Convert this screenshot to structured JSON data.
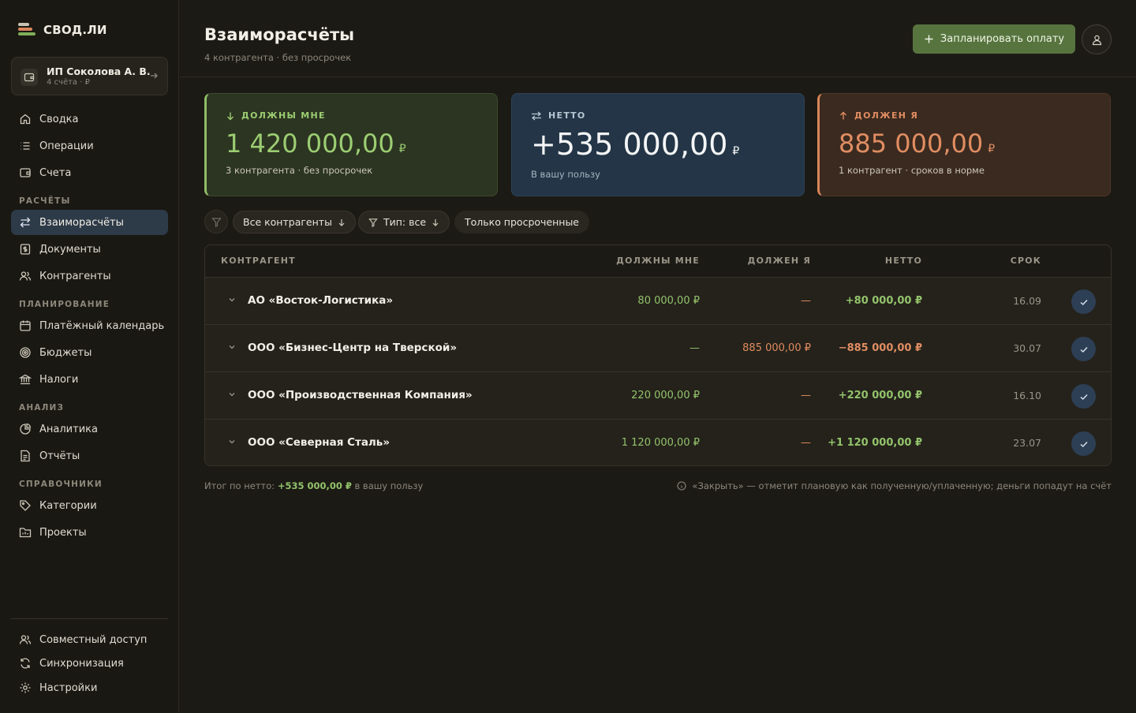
{
  "brand": {
    "name": "СВОД.ЛИ"
  },
  "account": {
    "name": "ИП Соколова А. В.",
    "sub": "4 счёта · ₽"
  },
  "nav": {
    "summary": "Сводка",
    "operations": "Операции",
    "accounts": "Счета",
    "section_settlements": "РАСЧЁТЫ",
    "settlements": "Взаиморасчёты",
    "documents": "Документы",
    "counterparties": "Контрагенты",
    "section_planning": "ПЛАНИРОВАНИЕ",
    "calendar": "Платёжный календарь",
    "budgets": "Бюджеты",
    "taxes": "Налоги",
    "section_analysis": "АНАЛИЗ",
    "analytics": "Аналитика",
    "reports": "Отчёты",
    "section_refs": "СПРАВОЧНИКИ",
    "categories": "Категории",
    "projects": "Проекты",
    "sharing": "Совместный доступ",
    "sync": "Синхронизация",
    "settings": "Настройки"
  },
  "header": {
    "title": "Взаиморасчёты",
    "subtitle": "4 контрагента · без просрочек",
    "plan_button": "Запланировать оплату"
  },
  "cards": {
    "owed": {
      "label": "ДОЛЖНЫ МНЕ",
      "value": "1 420 000,00",
      "currency": "₽",
      "note": "3 контрагента · без просрочек"
    },
    "net": {
      "label": "НЕТТО",
      "value": "+535 000,00",
      "currency": "₽",
      "note": "В вашу пользу"
    },
    "owe": {
      "label": "ДОЛЖЕН Я",
      "value": "885 000,00",
      "currency": "₽",
      "note": "1 контрагент · сроков в норме"
    }
  },
  "filters": {
    "counterparties": "Все контрагенты",
    "type": "Тип: все",
    "overdue": "Только просроченные"
  },
  "table": {
    "columns": {
      "counterparty": "КОНТРАГЕНТ",
      "owed": "ДОЛЖНЫ МНЕ",
      "owe": "ДОЛЖЕН Я",
      "net": "НЕТТО",
      "due": "СРОК"
    },
    "rows": [
      {
        "name": "АО «Восток-Логистика»",
        "owed": "80 000,00 ₽",
        "owe": "—",
        "net": "+80 000,00 ₽",
        "due": "16.09"
      },
      {
        "name": "ООО «Бизнес-Центр на Тверской»",
        "owed": "—",
        "owe": "885 000,00 ₽",
        "net": "−885 000,00 ₽",
        "due": "30.07"
      },
      {
        "name": "ООО «Производственная Компания»",
        "owed": "220 000,00 ₽",
        "owe": "—",
        "net": "+220 000,00 ₽",
        "due": "16.10"
      },
      {
        "name": "ООО «Северная Сталь»",
        "owed": "1 120 000,00 ₽",
        "owe": "—",
        "net": "+1 120 000,00 ₽",
        "due": "23.07"
      }
    ]
  },
  "footer": {
    "total_prefix": "Итог по нетто:",
    "total_value": "+535 000,00 ₽",
    "total_suffix": "в вашу пользу",
    "hint": "«Закрыть» — отметит плановую как полученную/уплаченную; деньги попадут на счёт"
  },
  "colors": {
    "background": "#1c1a15",
    "positive": "#93c36b",
    "negative": "#e08d62",
    "accent_button": "#57743f",
    "active_nav": "#2d3a48"
  }
}
